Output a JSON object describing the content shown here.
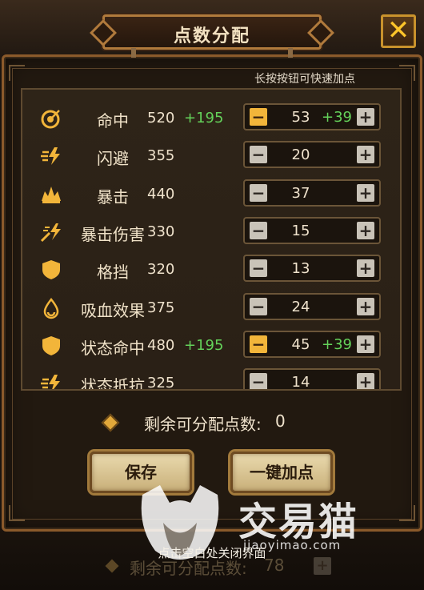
{
  "dialog": {
    "title": "点数分配",
    "close_glyph": "✕",
    "hint": "长按按钮可快速加点"
  },
  "stats": [
    {
      "name": "命中",
      "value": "520",
      "bonus": "+195",
      "points": "53",
      "points_bonus": "+39",
      "icon": "target-icon",
      "minus_active": true
    },
    {
      "name": "闪避",
      "value": "355",
      "bonus": "",
      "points": "20",
      "points_bonus": "",
      "icon": "dodge-lightning-icon",
      "minus_active": false
    },
    {
      "name": "暴击",
      "value": "440",
      "bonus": "",
      "points": "37",
      "points_bonus": "",
      "icon": "crit-burst-icon",
      "minus_active": false
    },
    {
      "name": "暴击伤害",
      "value": "330",
      "bonus": "",
      "points": "15",
      "points_bonus": "",
      "icon": "crit-damage-icon",
      "minus_active": false
    },
    {
      "name": "格挡",
      "value": "320",
      "bonus": "",
      "points": "13",
      "points_bonus": "",
      "icon": "shield-icon",
      "minus_active": false
    },
    {
      "name": "吸血效果",
      "value": "375",
      "bonus": "",
      "points": "24",
      "points_bonus": "",
      "icon": "blood-drop-icon",
      "minus_active": false
    },
    {
      "name": "状态命中",
      "value": "480",
      "bonus": "+195",
      "points": "45",
      "points_bonus": "+39",
      "icon": "status-shield-icon",
      "minus_active": true
    },
    {
      "name": "状态抵抗",
      "value": "325",
      "bonus": "",
      "points": "14",
      "points_bonus": "",
      "icon": "resist-lightning-icon",
      "minus_active": false
    }
  ],
  "stepper": {
    "minus": "−",
    "plus": "+"
  },
  "remaining": {
    "label": "剩余可分配点数:",
    "value": "0"
  },
  "buttons": {
    "save": "保存",
    "one_click": "一键加点"
  },
  "footer": {
    "close_hint": "点击空白处关闭界面"
  },
  "background_ghost": {
    "label": "剩余可分配点数:",
    "value": "78"
  },
  "watermark": {
    "text": "交易猫",
    "domain": "jiaoyimao.com"
  },
  "colors": {
    "accent_gold": "#f2b53a",
    "bonus_green": "#64d25a",
    "frame_brown": "#8b5a2b"
  }
}
